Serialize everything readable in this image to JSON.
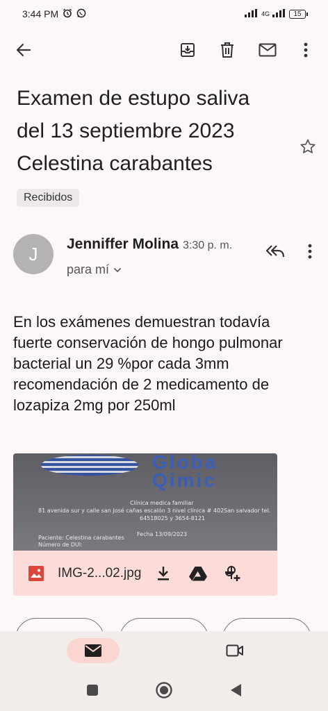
{
  "status_bar": {
    "time": "3:44 PM",
    "network": "4G",
    "battery": "15"
  },
  "toolbar": {
    "back_icon": "arrow-left-icon",
    "archive_icon": "archive-icon",
    "delete_icon": "trash-icon",
    "mark_unread_icon": "envelope-icon",
    "more_icon": "more-vert-icon"
  },
  "email": {
    "subject": "Examen de estupo saliva del 13 septiembre 2023 Celestina carabantes",
    "label": "Recibidos",
    "sender": {
      "avatar_letter": "J",
      "name": "Jenniffer Molina",
      "time": "3:30 p. m.",
      "to": "para mí"
    },
    "body": "En los exámenes demuestran todavía fuerte conservación de hongo pulmonar bacterial un 29 %por cada 3mm recomendación de 2 medicamento de lozapiza 2mg por 250ml",
    "attachment": {
      "file_name": "IMG-2...02.jpg",
      "preview": {
        "logo": "Globa Qimic",
        "clinic": "Clínica medica familiar",
        "address": "81 avenida sur  y calle san José cañas escalón 3 nivel clínica # 402San salvador tel.",
        "phones": "64518025 y 3654-8121",
        "date": "Fecha 13/09/2023",
        "patient": "Paciente: Celestina carabantes",
        "dui": "Número de DUI:"
      }
    }
  },
  "colors": {
    "background": "#fdf8f7",
    "attachment_bar": "#fbdcd8",
    "nav_active": "#fbd6d1",
    "avatar": "#b4b2b3",
    "image_icon": "#d9473d"
  }
}
